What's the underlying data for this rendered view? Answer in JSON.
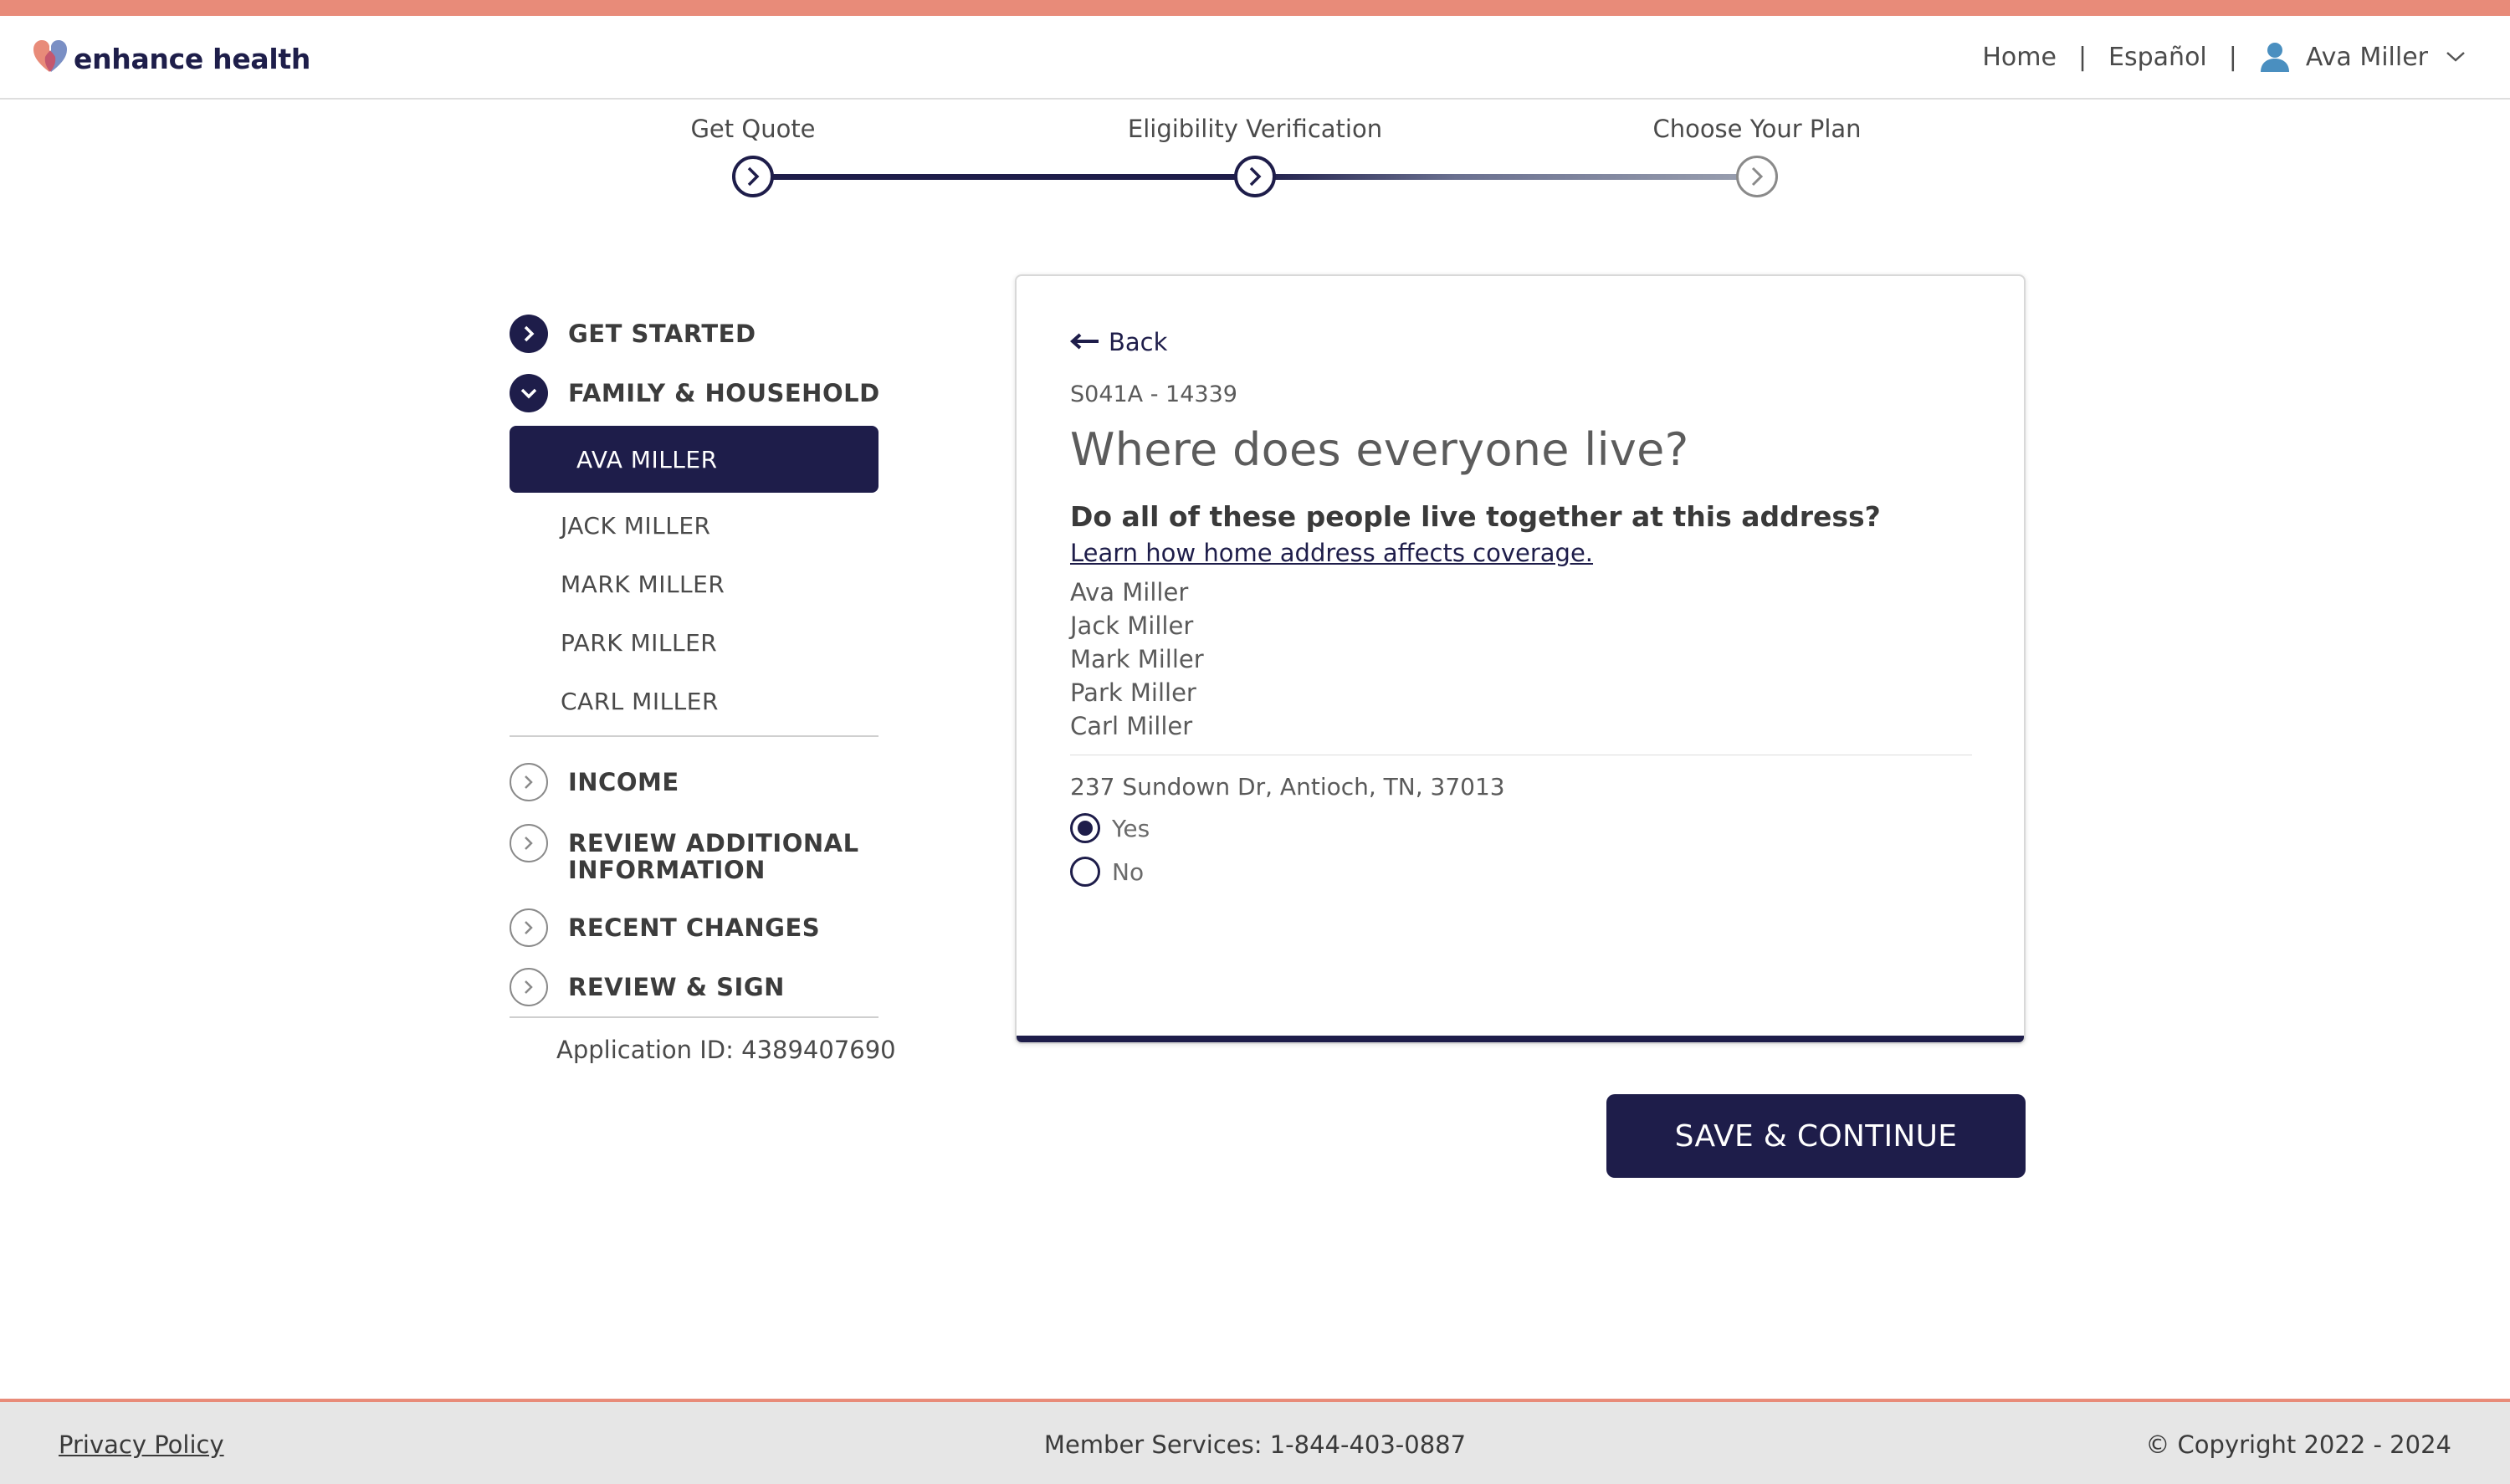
{
  "brand": {
    "name": "enhance health",
    "accent": "#e88b79",
    "navy": "#1e1d4a"
  },
  "header": {
    "nav": {
      "home": "Home",
      "language": "Español",
      "user": "Ava Miller"
    },
    "separator": "|"
  },
  "stepper": {
    "steps": [
      {
        "label": "Get Quote",
        "state": "complete"
      },
      {
        "label": "Eligibility Verification",
        "state": "current"
      },
      {
        "label": "Choose Your Plan",
        "state": "upcoming"
      }
    ]
  },
  "sidebar": {
    "sections": {
      "get_started": "GET STARTED",
      "family": "FAMILY & HOUSEHOLD",
      "income": "INCOME",
      "review_additional": "REVIEW ADDITIONAL INFORMATION",
      "recent_changes": "RECENT CHANGES",
      "review_sign": "REVIEW & SIGN"
    },
    "members": [
      "AVA MILLER",
      "JACK MILLER",
      "MARK MILLER",
      "PARK MILLER",
      "CARL MILLER"
    ],
    "active_member": "AVA MILLER",
    "application_id": "Application ID: 4389407690"
  },
  "card": {
    "back": "Back",
    "code": "S041A - 14339",
    "title": "Where does everyone live?",
    "question": "Do all of these people live together at this address?",
    "learn_link": "Learn how home address affects coverage.",
    "people": [
      "Ava Miller",
      "Jack Miller",
      "Mark Miller",
      "Park Miller",
      "Carl Miller"
    ],
    "address": "237 Sundown Dr, Antioch, TN, 37013",
    "options": {
      "yes": "Yes",
      "no": "No"
    },
    "selected": "Yes"
  },
  "actions": {
    "save": "SAVE & CONTINUE"
  },
  "footer": {
    "privacy": "Privacy Policy",
    "services": "Member Services: 1-844-403-0887",
    "copyright": "© Copyright 2022 - 2024"
  }
}
